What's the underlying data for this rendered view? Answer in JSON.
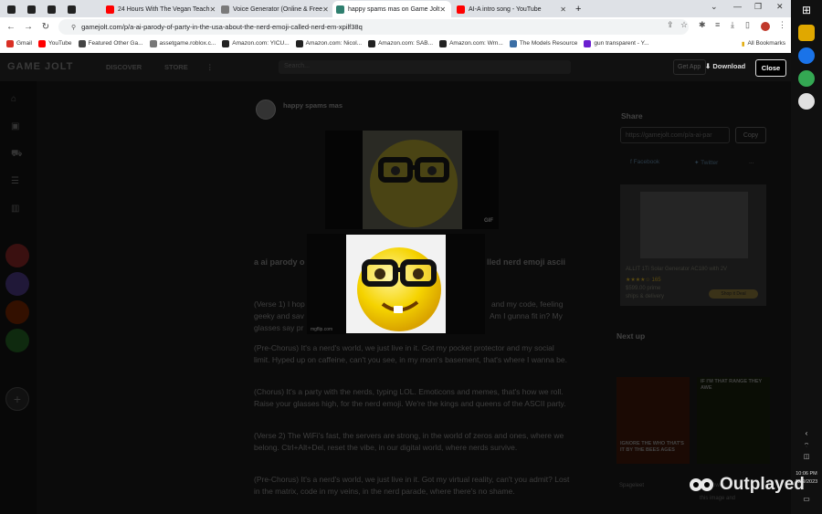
{
  "browser": {
    "tabs": [
      {
        "label": "",
        "fav_color": "#222222"
      },
      {
        "label": "",
        "fav_color": "#222222"
      },
      {
        "label": "",
        "fav_color": "#222222"
      },
      {
        "label": "",
        "fav_color": "#222222"
      },
      {
        "label": "24 Hours With The Vegan Teach",
        "fav_color": "#ff0000"
      },
      {
        "label": "Voice Generator (Online & Free",
        "fav_color": "#7a7a7a"
      },
      {
        "label": "happy spams mas on Game Jolt",
        "fav_color": "#2f7f6f"
      },
      {
        "label": "AI-A intro song - YouTube",
        "fav_color": "#ff0000"
      }
    ],
    "new_tab_label": "+",
    "url": "gamejolt.com/p/a-ai-parody-of-party-in-the-usa-about-the-nerd-emoji-called-nerd-em-xpilf38q",
    "bookmarks": [
      {
        "label": "Gmail",
        "color": "#d93025"
      },
      {
        "label": "YouTube",
        "color": "#ff0000"
      },
      {
        "label": "Featured Other Ga...",
        "color": "#444444"
      },
      {
        "label": "assetgame.roblox.c...",
        "color": "#777777"
      },
      {
        "label": "Amazon.com: YICU...",
        "color": "#222222"
      },
      {
        "label": "Amazon.com: Nicol...",
        "color": "#222222"
      },
      {
        "label": "Amazon.com: SAB...",
        "color": "#222222"
      },
      {
        "label": "Amazon.com: Wrn...",
        "color": "#222222"
      },
      {
        "label": "The Models Resource",
        "color": "#3b6ea5"
      },
      {
        "label": "gun transparent - Y...",
        "color": "#6a1fd0"
      }
    ],
    "all_bookmarks": "All Bookmarks"
  },
  "gamejolt": {
    "logo": "GAME JOLT",
    "nav": [
      "DISCOVER",
      "STORE"
    ],
    "search_placeholder": "Search...",
    "get_app": "Get App",
    "download": "Download",
    "close": "Close"
  },
  "post": {
    "author": "happy spams mas",
    "gif_tag": "GIF",
    "title_left": "a ai parody o",
    "title_right": "lled nerd emoji ascii",
    "verse1_left": "(Verse 1) I hop",
    "verse1_right": "and my code, feeling",
    "verse1_l2_left": "geeky and sav",
    "verse1_l2_right": "Am I gunna fit in? My",
    "verse1_l3": "glasses say pr",
    "prechorus1": "(Pre-Chorus) It's a nerd's world, we just live in it. Got my pocket protector and my social limit. Hyped up on caffeine, can't you see, in my mom's basement, that's where I wanna be.",
    "chorus": "(Chorus) It's a party with the nerds, typing LOL. Emoticons and memes, that's how we roll. Raise your glasses high, for the nerd emoji. We're the kings and queens of the ASCII party.",
    "verse2": "(Verse 2) The WiFi's fast, the servers are strong, in the world of zeros and ones, where we belong. Ctrl+Alt+Del, reset the vibe, in our digital world, where nerds survive.",
    "prechorus2": "(Pre-Chorus) It's a nerd's world, we just live in it. Got my virtual reality, can't you admit? Lost in the matrix, code in my veins, in the nerd parade, where there's no shame."
  },
  "lightbox": {
    "watermark": "mgflip.com"
  },
  "sidebar_right": {
    "share_heading": "Share",
    "share_url": "https://gamejolt.com/p/a-ai-par",
    "copy": "Copy",
    "facebook": "Facebook",
    "twitter": "Twitter",
    "more": "...",
    "ad_line1": "ALLIT 1Ti Solar Generator AC180 with 2V",
    "ad_rating": "★★★★☆ 165",
    "ad_price": "$599.00 prime",
    "ad_ship": "ships & delivery",
    "ad_button": "Shop it Deal",
    "next_up": "Next up",
    "thumb1_caption": "IGNORE THE WHO THAT'S IT BY THE BEES AGES",
    "thumb2_caption": "IF I'M THAT RANGE THEY AWE",
    "thumb1_author": "Spageleet",
    "thumb2_author": "Steamwes",
    "thumb2_meta": "this image and"
  },
  "taskbar": {
    "time": "10:06 PM",
    "date": "12/9/2023"
  },
  "watermark": {
    "text": "Outplayed"
  },
  "colors": {
    "accent": "#ccff00",
    "page_bg": "#0b0b0b",
    "chrome_tab_bg": "#dee1e6"
  }
}
